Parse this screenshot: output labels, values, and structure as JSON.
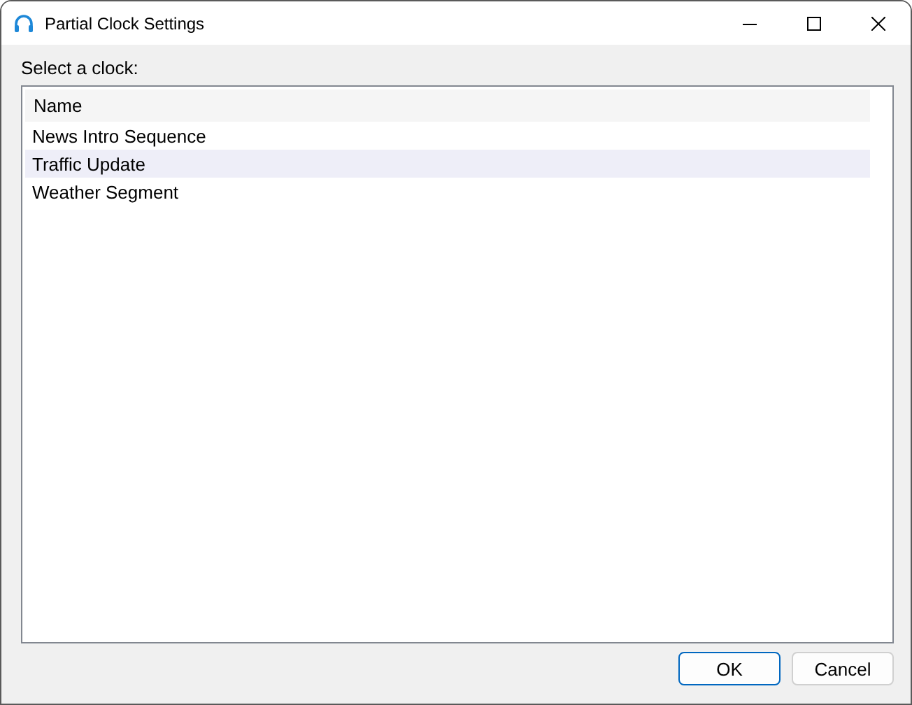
{
  "window": {
    "title": "Partial Clock Settings"
  },
  "prompt": "Select a clock:",
  "list": {
    "columns": [
      "Name"
    ],
    "rows": [
      {
        "name": "News Intro Sequence",
        "selected": false
      },
      {
        "name": "Traffic Update",
        "selected": true
      },
      {
        "name": "Weather Segment",
        "selected": false
      }
    ]
  },
  "buttons": [
    {
      "label": "OK",
      "kind": "default"
    },
    {
      "label": "Cancel",
      "kind": "normal"
    }
  ]
}
